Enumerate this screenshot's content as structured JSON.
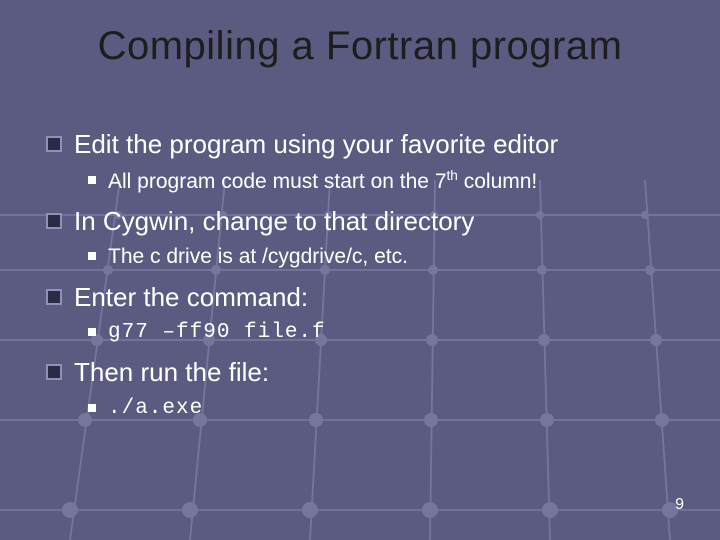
{
  "title": "Compiling a Fortran program",
  "items": [
    {
      "text": "Edit the program using your favorite editor",
      "sub": [
        {
          "pre": "All program code must start on the 7",
          "sup": "th",
          "post": " column!"
        }
      ]
    },
    {
      "text": "In Cygwin, change to that directory",
      "sub": [
        {
          "pre": "The c drive is at /cygdrive/c, etc."
        }
      ]
    },
    {
      "text": "Enter the command:",
      "sub": [
        {
          "mono": "g77 –ff90 file.f"
        }
      ]
    },
    {
      "text": "Then run the file:",
      "sub": [
        {
          "mono": "./a.exe"
        }
      ]
    }
  ],
  "page": "9"
}
